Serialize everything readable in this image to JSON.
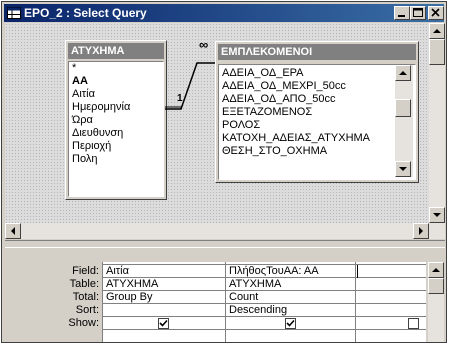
{
  "window": {
    "title": "EPO_2 : Select Query",
    "controls": [
      "minimize-icon",
      "maximize-icon",
      "close-icon"
    ]
  },
  "tables": [
    {
      "name": "ΑΤΥΧΗΜΑ",
      "fields": [
        "*",
        "AA",
        "Αιτία",
        "Ημερομηνία",
        "Ώρα",
        "Διευθυνση",
        "Περιοχή",
        "Πολη"
      ]
    },
    {
      "name": "ΕΜΠΛΕΚΟΜΕΝΟΙ",
      "fields": [
        "ΑΔΕΙΑ_ΟΔ_ΕΡΑ",
        "ΑΔΕΙΑ_ΟΔ_ΜΕΧΡΙ_50cc",
        "ΑΔΕΙΑ_ΟΔ_ΑΠΟ_50cc",
        "ΕΞΕΤΑΖΟΜΕΝΟΣ",
        "ΡΟΛΟΣ",
        "ΚΑΤΟΧΗ_ΑΔΕΙΑΣ_ΑΤΥΧΗΜΑ",
        "ΘΕΣΗ_ΣΤΟ_ΟΧΗΜΑ"
      ]
    }
  ],
  "join": {
    "one_label": "1",
    "many_label": "∞"
  },
  "design_grid": {
    "row_labels": [
      "Field:",
      "Table:",
      "Total:",
      "Sort:",
      "Show:"
    ],
    "columns": [
      {
        "field": "Αιτία",
        "table": "ΑΤΥΧΗΜΑ",
        "total": "Group By",
        "sort": "",
        "show": true
      },
      {
        "field": "ΠλήθοςΤουAA: AA",
        "table": "ΑΤΥΧΗΜΑ",
        "total": "Count",
        "sort": "Descending",
        "show": true
      },
      {
        "field": "",
        "table": "",
        "total": "",
        "sort": "",
        "show": false
      }
    ]
  },
  "colors": {
    "title_bar": "#0a246a",
    "table_header": "#808080"
  }
}
